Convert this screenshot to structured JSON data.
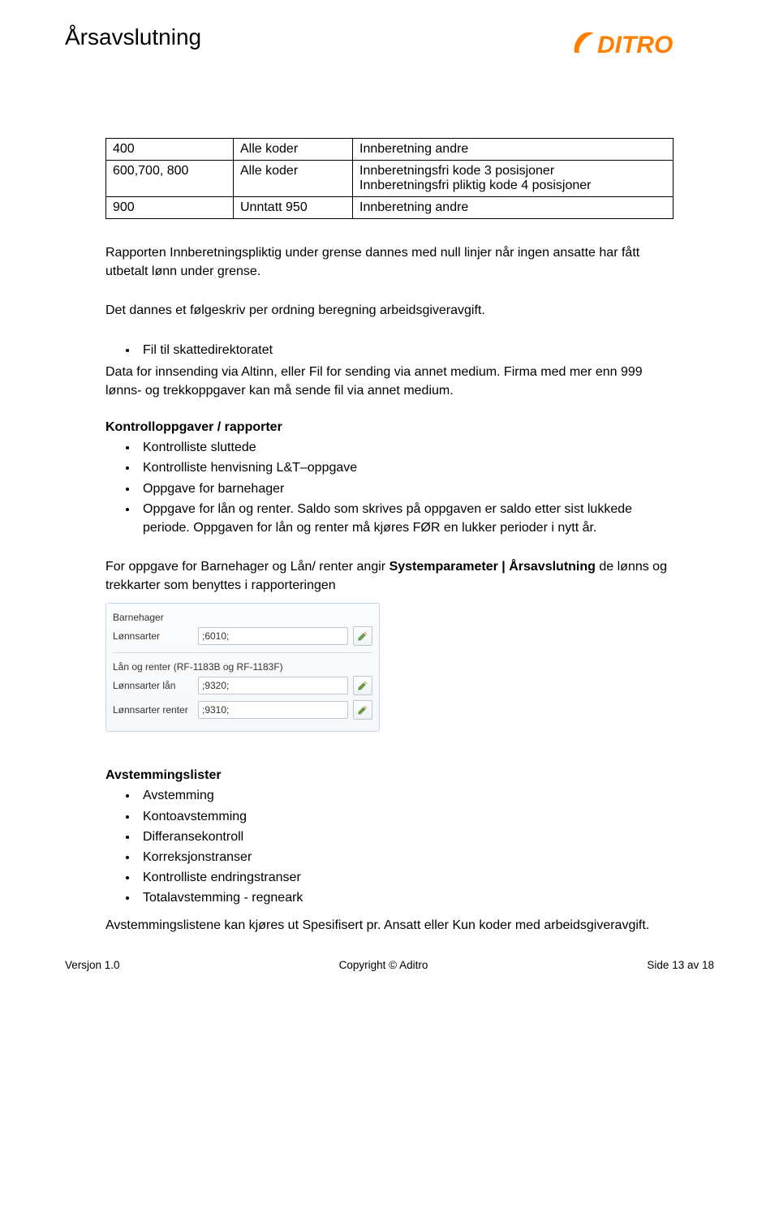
{
  "header": {
    "title": "Årsavslutning",
    "logo_text": "aDITRO"
  },
  "table": {
    "rows": [
      {
        "c1": "400",
        "c2": "Alle koder",
        "c3": "Innberetning andre"
      },
      {
        "c1": "600,700, 800",
        "c2": "Alle koder",
        "c3": "Innberetningsfri kode 3 posisjoner\nInnberetningsfri pliktig kode 4 posisjoner"
      },
      {
        "c1": "900",
        "c2": "Unntatt 950",
        "c3": "Innberetning andre"
      }
    ]
  },
  "paragraphs": {
    "p1": "Rapporten Innberetningspliktig under grense dannes med null linjer når ingen ansatte har fått utbetalt lønn under grense.",
    "p2": "Det dannes et følgeskriv per ordning beregning arbeidsgiveravgift.",
    "bullet_fs": "Fil til skattedirektoratet",
    "p3a": "Data for innsending via Altinn, eller Fil for sending via annet medium. Firma med mer enn 999 lønns- og trekkoppgaver kan må sende fil via annet medium.",
    "heading_kontroll": "Kontrolloppgaver / rapporter",
    "kontroll_items": [
      "Kontrolliste sluttede",
      "Kontrolliste henvisning L&T–oppgave",
      "Oppgave for barnehager",
      "Oppgave for lån og renter. Saldo som skrives på oppgaven er saldo etter sist lukkede periode. Oppgaven for lån og renter må kjøres FØR en lukker perioder i nytt år."
    ],
    "syspar_pre": "For oppgave for Barnehager og Lån/ renter angir ",
    "syspar_bold": "Systemparameter | Årsavslutning",
    "syspar_post": " de lønns og trekkarter som benyttes i rapporteringen",
    "heading_avstem": "Avstemmingslister",
    "avstem_items": [
      "Avstemming",
      "Kontoavstemming",
      "Differansekontroll",
      "Korreksjonstranser",
      "Kontrolliste endringstranser",
      "Totalavstemming - regneark"
    ],
    "p_avstem_foot": "Avstemmingslistene kan kjøres ut Spesifisert pr. Ansatt eller Kun koder med arbeidsgiveravgift."
  },
  "form": {
    "group1": "Barnehager",
    "field1_label": "Lønnsarter",
    "field1_value": ";6010;",
    "group2": "Lån og renter (RF-1183B og RF-1183F)",
    "field2_label": "Lønnsarter lån",
    "field2_value": ";9320;",
    "field3_label": "Lønnsarter renter",
    "field3_value": ";9310;"
  },
  "footer": {
    "left": "Versjon 1.0",
    "center": "Copyright © Aditro",
    "right": "Side 13 av 18"
  }
}
